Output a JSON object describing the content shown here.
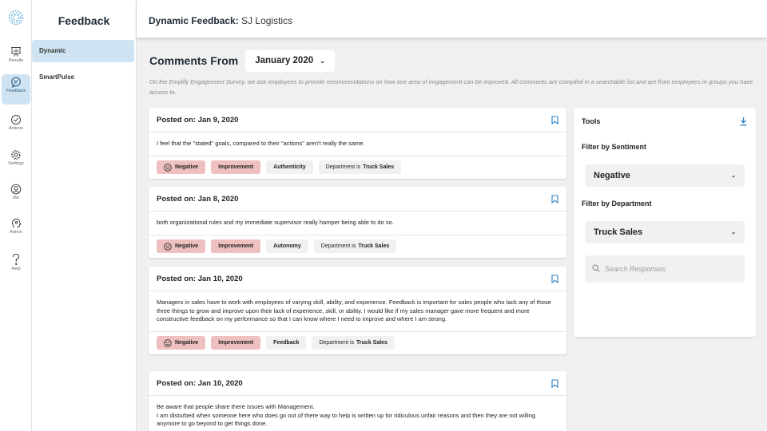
{
  "rail": {
    "items": [
      {
        "label": "Results"
      },
      {
        "label": "Feedback"
      },
      {
        "label": "Actions"
      },
      {
        "label": "Settings"
      },
      {
        "label": "Me"
      },
      {
        "label": "Admin"
      },
      {
        "label": "Help"
      }
    ],
    "active": "Feedback"
  },
  "subnav": {
    "title": "Feedback",
    "items": [
      {
        "label": "Dynamic",
        "active": true
      },
      {
        "label": "SmartPulse",
        "active": false
      }
    ]
  },
  "header": {
    "title_bold": "Dynamic Feedback:",
    "title_rest": " SJ Logistics"
  },
  "main": {
    "title": "Comments From",
    "month": "January 2020",
    "description": "On the Emplify Engagement Survey, we ask employees to provide recommendations on how one area of engagement can be improved. All comments are compiled in a searchable list and are from employees in groups you have access to."
  },
  "comments": [
    {
      "posted": "Posted on: Jan 9, 2020",
      "text": "I feel that the \"stated\" goals, compared to their \"actions\" aren't really the same.",
      "sentiment": "Negative",
      "type": "Improvement",
      "topic": "Authenticity",
      "dept_prefix": "Department is",
      "dept": "Truck Sales"
    },
    {
      "posted": "Posted on: Jan 8, 2020",
      "text": "both organizational rules and my immediate supervisor really hamper being able to do so.",
      "sentiment": "Negative",
      "type": "Improvement",
      "topic": "Autonomy",
      "dept_prefix": "Department is",
      "dept": "Truck Sales"
    },
    {
      "posted": "Posted on: Jan 10, 2020",
      "text": "Managers in sales have to work with employees of varying skill, ability, and experience. Feedback is important for sales people who lack any of those three things to grow and improve upon their lack of experience, skill, or ability. I would like if my sales manager gave more frequent and more constructive feedback on my performance so that I can know where I need to improve and where I am strong.",
      "sentiment": "Negative",
      "type": "Improvement",
      "topic": "Feedback",
      "dept_prefix": "Department is",
      "dept": "Truck Sales"
    },
    {
      "posted": "Posted on: Jan 10, 2020",
      "text": "Be aware that people share there issues with Management.\n  I am disturbed when someone here who does go out of there way to help is written up for ridiculous unfair reasons and then they are not willing anymore to go beyond to get things done."
    }
  ],
  "tools": {
    "title": "Tools",
    "sentiment_label": "Filter by Sentiment",
    "sentiment_value": "Negative",
    "department_label": "Filter by Department",
    "department_value": "Truck Sales",
    "search_placeholder": "Search Responses"
  },
  "colors": {
    "accent": "#2a7fc1",
    "active_nav": "#cfe3f2",
    "tag_negative": "#efc0c0"
  }
}
